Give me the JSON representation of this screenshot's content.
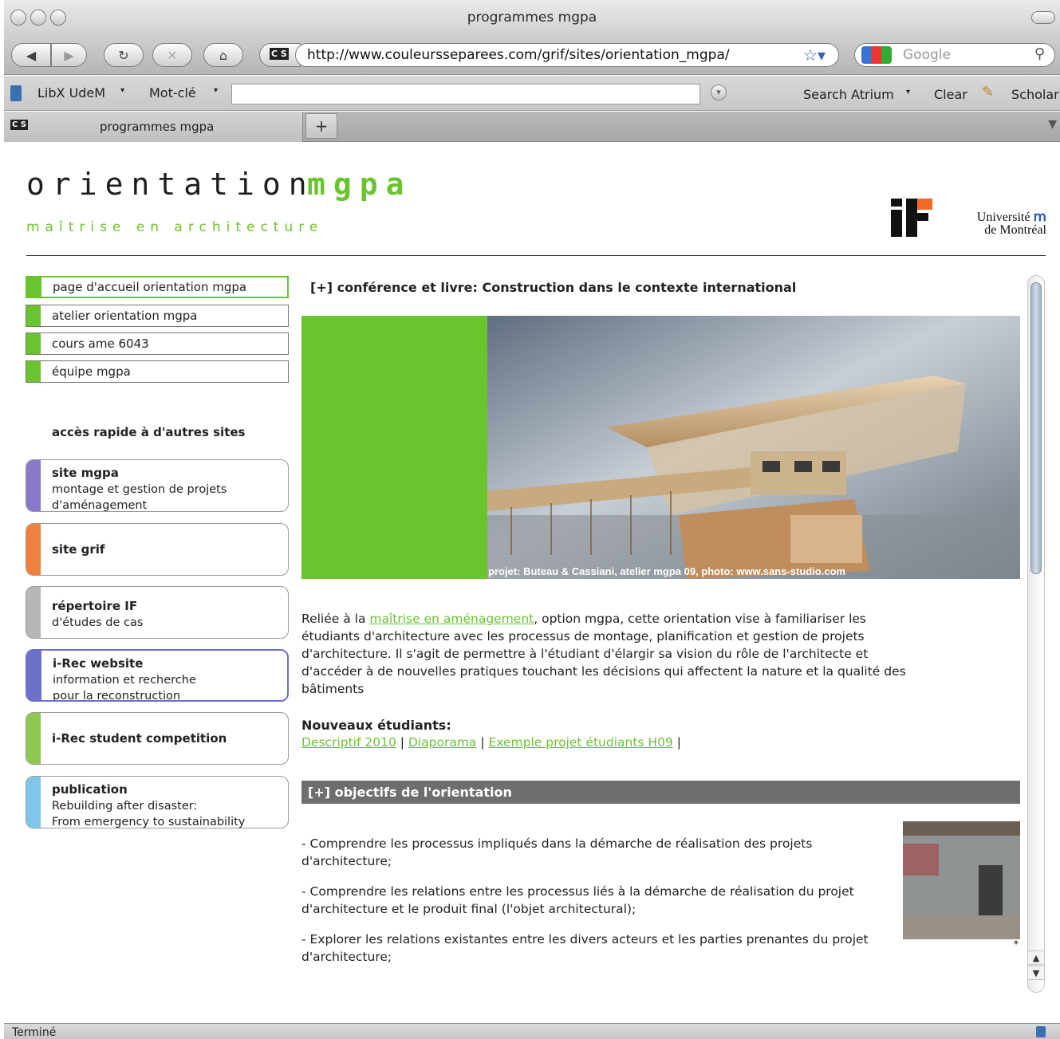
{
  "window": {
    "title": "programmes mgpa"
  },
  "toolbar": {
    "url": "http://www.couleursseparees.com/grif/sites/orientation_mgpa/",
    "search_placeholder": "Google",
    "site_badge": "C S"
  },
  "libx": {
    "app_label": "LibX UdeM",
    "mode_label": "Mot-clé",
    "search_label": "Search Atrium",
    "clear_label": "Clear",
    "scholar_label": "Scholar"
  },
  "tabs": [
    {
      "label": "programmes mgpa"
    }
  ],
  "header": {
    "logo_word1": "orientation",
    "logo_word2": "mgpa",
    "tagline": "maîtrise en architecture",
    "udem_line1": "Université",
    "udem_line2": "de Montréal"
  },
  "nav": [
    {
      "label": "page d'accueil orientation mgpa"
    },
    {
      "label": "atelier orientation mgpa"
    },
    {
      "label": "cours ame 6043"
    },
    {
      "label": "équipe mgpa"
    }
  ],
  "quick_access_title": "accès rapide à d'autres sites",
  "cards": [
    {
      "title": "site mgpa",
      "line1": "montage et gestion de projets",
      "line2": "d'aménagement",
      "color": "#8a79c9"
    },
    {
      "title": "site grif",
      "line1": "",
      "line2": "",
      "color": "#f0803c"
    },
    {
      "title": "répertoire IF",
      "line1": "d'études de cas",
      "line2": "",
      "color": "#b7b7b7"
    },
    {
      "title": "i-Rec website",
      "line1": "information et recherche",
      "line2": "pour la reconstruction",
      "color": "#6b70c9"
    },
    {
      "title": "i-Rec student competition",
      "line1": "",
      "line2": "",
      "color": "#8fc850"
    },
    {
      "title": "publication",
      "line1": "Rebuilding after disaster:",
      "line2": "From emergency to sustainability",
      "color": "#7ec7ea"
    }
  ],
  "content": {
    "conference_heading": "[+] conférence et livre: Construction dans le contexte international",
    "banner_caption": "projet: Buteau & Cassiani, atelier mgpa 09, photo: www.sans-studio.com",
    "intro_pre": "Reliée à la ",
    "intro_link": "maîtrise en aménagement",
    "intro_post": ", option mgpa, cette orientation vise à familiariser les étudiants d'architecture avec les processus de montage, planification et gestion de projets d'architecture. Il s'agit de permettre à l'étudiant d'élargir sa vision du rôle de l'architecte et d'accéder à de nouvelles pratiques touchant les décisions qui affectent la nature et la qualité des bâtiments",
    "new_students_title": "Nouveaux étudiants:",
    "new_links": [
      "Descriptif 2010",
      "Diaporama",
      "Exemple projet étudiants H09"
    ],
    "objectives_heading": "[+] objectifs de l'orientation",
    "objectives": [
      "- Comprendre les processus impliqués dans la démarche de réalisation des projets d'architecture;",
      "- Comprendre les relations entre les processus liés à la démarche de réalisation du projet d'architecture et le produit final (l'objet architectural);",
      "- Explorer les relations existantes entre les divers acteurs et les parties prenantes du projet d'architecture;"
    ],
    "thumb_mark": "*"
  },
  "status": {
    "text": "Terminé"
  },
  "colors": {
    "accent_green": "#6ac42d",
    "objectives_bar": "#6e6e6e"
  }
}
